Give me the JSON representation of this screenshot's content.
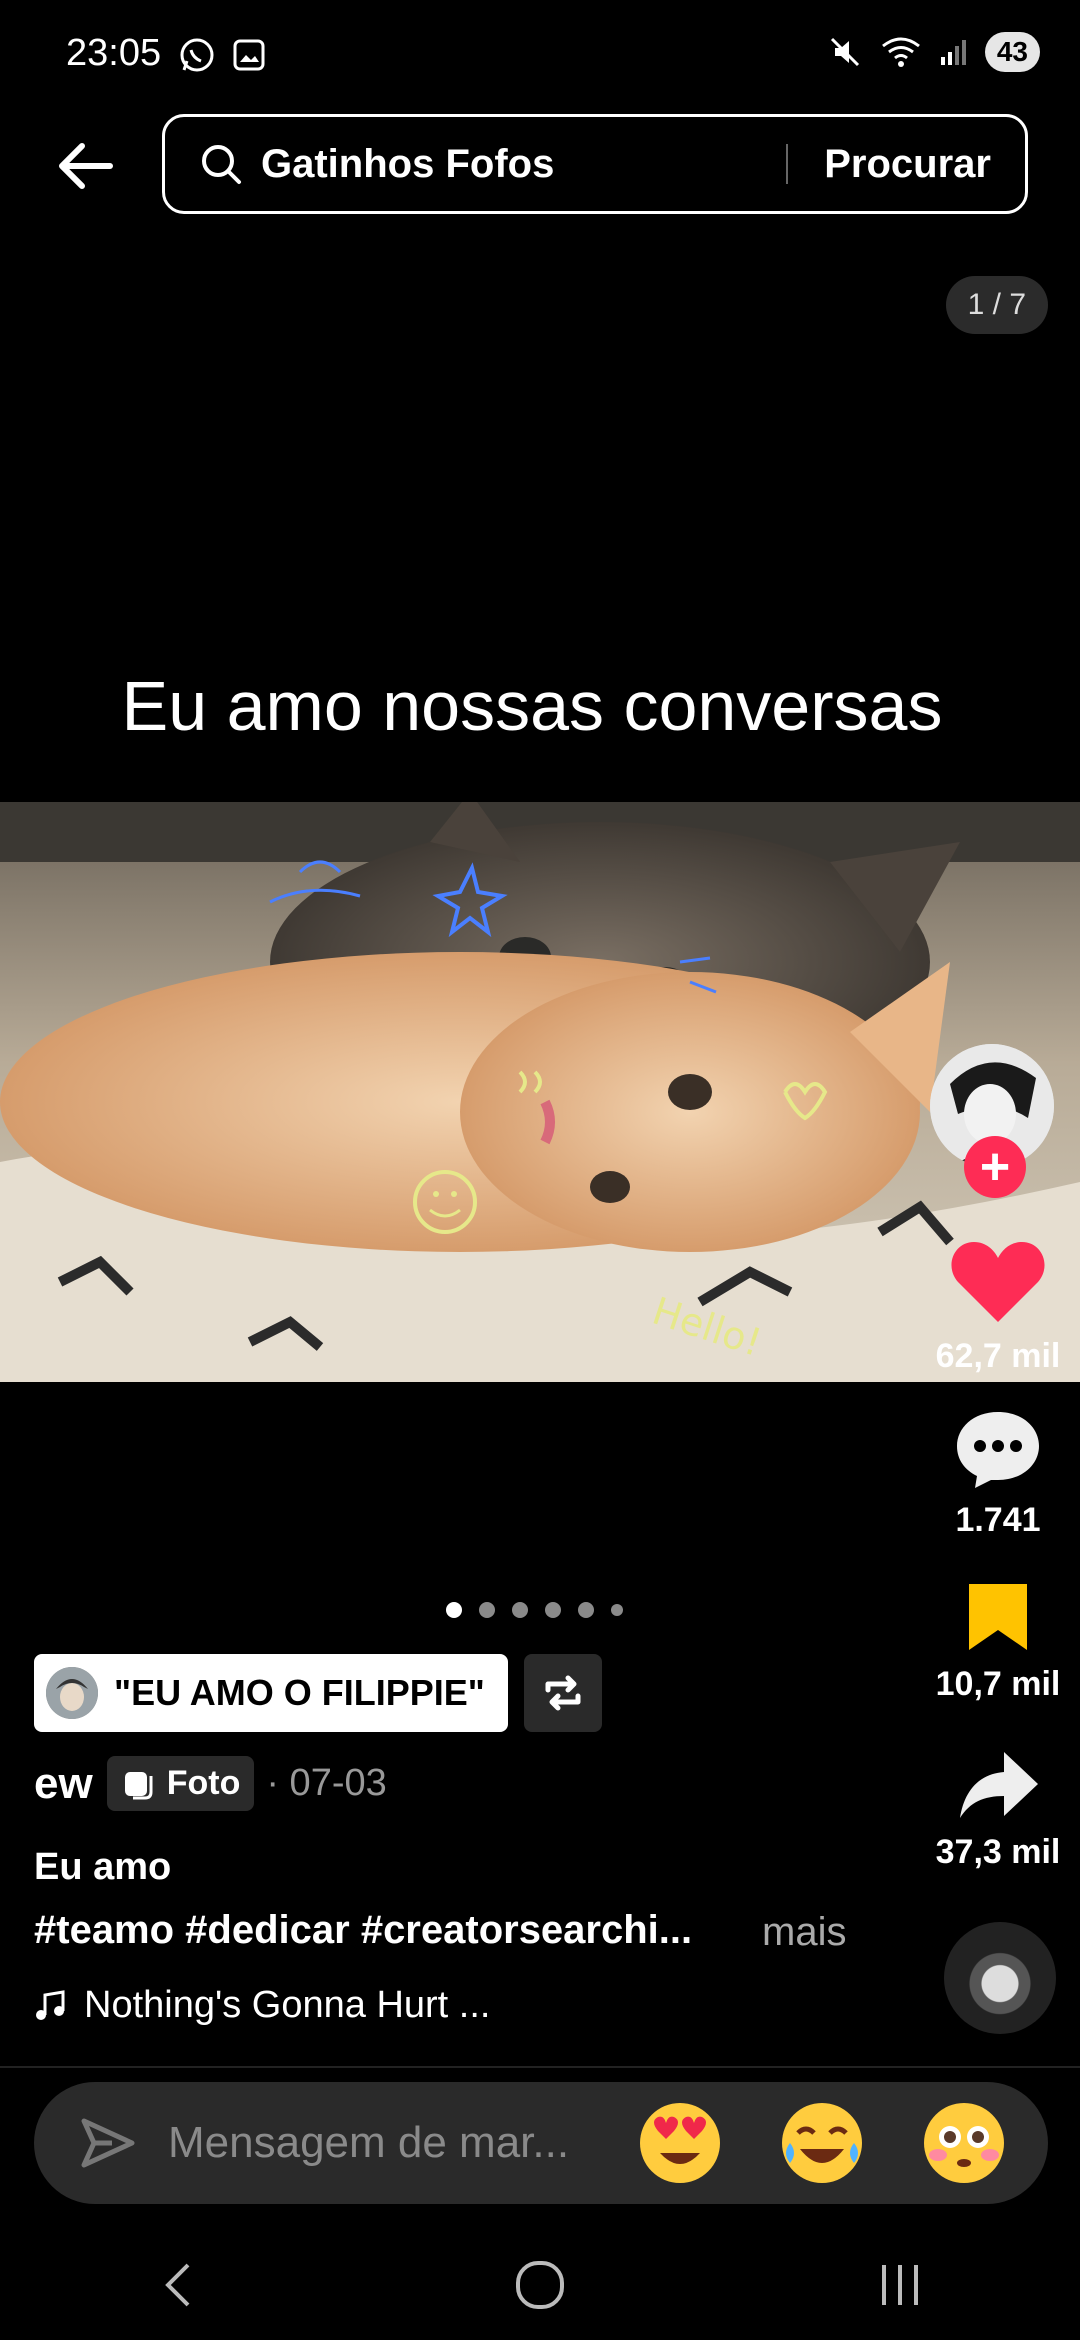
{
  "status_bar": {
    "time": "23:05",
    "battery": "43"
  },
  "header": {
    "search_query": "Gatinhos Fofos",
    "search_button": "Procurar"
  },
  "page_counter": "1 / 7",
  "post": {
    "overlay_caption": "Eu amo nossas conversas",
    "photo_doodle_text": "Hello!",
    "sticker_text": "\"EU AMO O FILIPPIE\"",
    "author": "ew",
    "type_badge": "Foto",
    "date": "· 07-03",
    "title": "Eu amo",
    "hashtags": "#teamo #dedicar #creatorsearchi...",
    "more": "mais",
    "music": "Nothing's Gonna Hurt ...",
    "carousel": {
      "count": 6,
      "active": 0
    }
  },
  "actions": {
    "likes": "62,7 mil",
    "comments": "1.741",
    "saves": "10,7 mil",
    "shares": "37,3 mil"
  },
  "message_bar": {
    "placeholder": "Mensagem de mar..."
  },
  "colors": {
    "like": "#fe2c55",
    "save": "#ffc300",
    "background": "#000000"
  }
}
